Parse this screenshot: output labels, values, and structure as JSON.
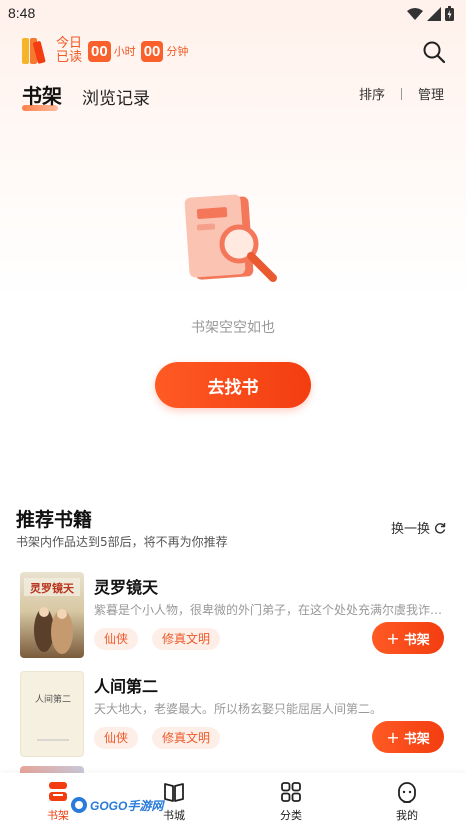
{
  "status_bar": {
    "time": "8:48"
  },
  "reading": {
    "today_label": "今日已读",
    "hours": "00",
    "hours_unit": "小时",
    "minutes": "00",
    "minutes_unit": "分钟"
  },
  "tabs": {
    "active": "书架",
    "other": "浏览记录"
  },
  "actions": {
    "sort": "排序",
    "manage": "管理"
  },
  "empty": {
    "message": "书架空空如也",
    "button": "去找书"
  },
  "recommend": {
    "title": "推荐书籍",
    "subtitle": "书架内作品达到5部后，将不再为你推荐",
    "refresh": "换一换",
    "add_label": "书架",
    "books": [
      {
        "title": "灵罗镜天",
        "desc": "紫暮是个小人物，很卑微的外门弟子，在这个处处充满尔虞我诈的世界",
        "tags": [
          "仙侠",
          "修真文明"
        ],
        "cover_text": "灵罗镜天"
      },
      {
        "title": "人间第二",
        "desc": "天大地大，老婆最大。所以杨玄娶只能屈居人间第二。",
        "tags": [
          "仙侠",
          "修真文明"
        ],
        "cover_text": "人间第二"
      }
    ]
  },
  "nav": {
    "shelf": "书架",
    "city": "书城",
    "category": "分类",
    "mine": "我的"
  },
  "watermark": {
    "text": "GOGO手游网"
  },
  "colors": {
    "accent": "#f33d10",
    "tag_bg": "#fdeee8"
  }
}
